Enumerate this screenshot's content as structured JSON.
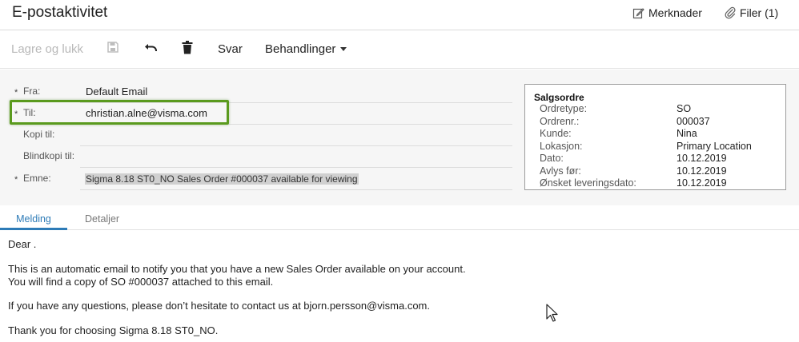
{
  "header": {
    "title": "E-postaktivitet",
    "notes_label": "Merknader",
    "files_label": "Filer (1)"
  },
  "toolbar": {
    "save_close_label": "Lagre og lukk",
    "save_icon": "floppy-disk-icon",
    "undo_icon": "undo-icon",
    "delete_icon": "trash-icon",
    "reply_label": "Svar",
    "actions_label": "Behandlinger"
  },
  "form": {
    "from_label": "Fra:",
    "from_value": "Default Email",
    "to_label": "Til:",
    "to_value": "christian.alne@visma.com",
    "cc_label": "Kopi til:",
    "cc_value": "",
    "bcc_label": "Blindkopi til:",
    "bcc_value": "",
    "subject_label": "Emne:",
    "subject_value": "Sigma 8.18 ST0_NO Sales Order #000037 available for viewing",
    "required_mark": "*"
  },
  "sales_order": {
    "title": "Salgsordre",
    "fields": [
      {
        "label": "Ordretype:",
        "value": "SO"
      },
      {
        "label": "Ordrenr.:",
        "value": "000037"
      },
      {
        "label": "Kunde:",
        "value": "Nina"
      },
      {
        "label": "Lokasjon:",
        "value": "Primary Location"
      },
      {
        "label": "Dato:",
        "value": "10.12.2019"
      },
      {
        "label": "Avlys før:",
        "value": "10.12.2019"
      },
      {
        "label": "Ønsket leveringsdato:",
        "value": "10.12.2019"
      }
    ]
  },
  "tabs": {
    "message": "Melding",
    "details": "Detaljer"
  },
  "message": {
    "greeting": "Dear .",
    "line1": "This is an automatic email to notify you that you have a new Sales Order available on your account.",
    "line2": "You will find a copy of SO #000037 attached to this email.",
    "line3": "If you have any questions, please don’t hesitate to contact us at bjorn.persson@visma.com.",
    "line4": "Thank you for choosing Sigma 8.18 ST0_NO."
  },
  "colors": {
    "accent": "#2d7bb7",
    "highlight_border": "#5a9a1e",
    "form_background": "#f6f6f6"
  }
}
